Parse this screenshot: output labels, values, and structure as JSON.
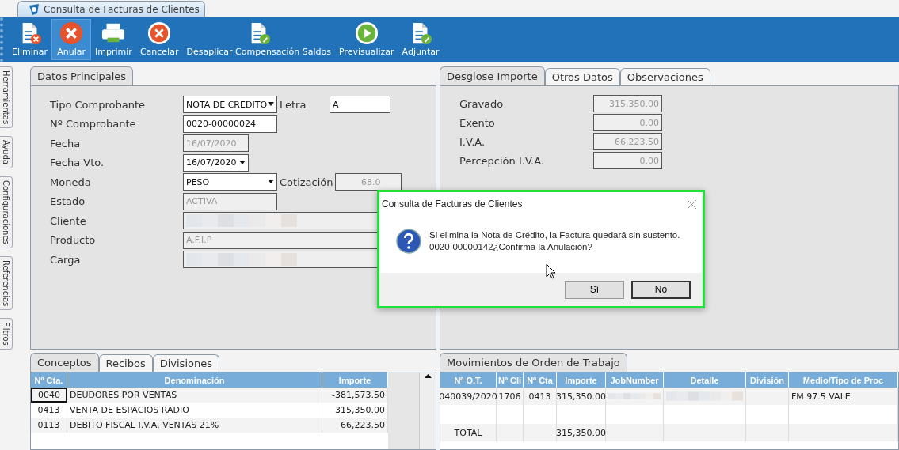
{
  "window": {
    "title": "Consulta de Facturas de Clientes"
  },
  "toolbar": [
    {
      "label": "Eliminar",
      "kind": "doc-x",
      "selected": false
    },
    {
      "label": "Anular",
      "kind": "x-circle",
      "selected": true
    },
    {
      "label": "Imprimir",
      "kind": "printer",
      "selected": false
    },
    {
      "label": "Cancelar",
      "kind": "x-ring",
      "selected": false
    },
    {
      "label": "Desaplicar Compensación Saldos",
      "kind": "doc-clip",
      "selected": false
    },
    {
      "label": "Previsualizar",
      "kind": "play",
      "selected": false
    },
    {
      "label": "Adjuntar",
      "kind": "doc-clip",
      "selected": false
    }
  ],
  "side_tabs": [
    "Herramientas",
    "Ayuda",
    "Configuraciones",
    "Referencias",
    "Filtros"
  ],
  "main_tabs": [
    {
      "label": "Datos Principales",
      "selected": true
    }
  ],
  "main_fields": [
    {
      "label": "Tipo Comprobante",
      "value": "NOTA DE CREDITO",
      "kind": "combo",
      "extra": {
        "label": "Letra",
        "value": "A",
        "kind": "input"
      }
    },
    {
      "label": "Nº Comprobante",
      "value": "0020-00000024",
      "kind": "input"
    },
    {
      "label": "Fecha",
      "value": "16/07/2020",
      "kind": "readonly"
    },
    {
      "label": "Fecha Vto.",
      "value": "16/07/2020",
      "kind": "combo"
    },
    {
      "label": "Moneda",
      "value": "PESO",
      "kind": "combo",
      "extra": {
        "label": "Cotización",
        "value": "68.0",
        "kind": "readonly"
      }
    },
    {
      "label": "Estado",
      "value": "ACTIVA",
      "kind": "readonly"
    },
    {
      "label": "Cliente",
      "kind": "readonly",
      "redacted": true
    },
    {
      "label": "Producto",
      "value": "A.F.I.P",
      "kind": "readonly"
    },
    {
      "label": "Carga",
      "kind": "readonly",
      "redacted": true
    }
  ],
  "detail_tabs": [
    {
      "label": "Desglose Importe",
      "selected": true
    },
    {
      "label": "Otros Datos",
      "selected": false
    },
    {
      "label": "Observaciones",
      "selected": false
    }
  ],
  "detail_fields": [
    {
      "label": "Gravado",
      "value": "315,350.00"
    },
    {
      "label": "Exento",
      "value": "0.00"
    },
    {
      "label": "I.V.A.",
      "value": "66,223.50"
    },
    {
      "label": "Percepción I.V.A.",
      "value": "0.00"
    }
  ],
  "concepts_tabs": [
    {
      "label": "Conceptos",
      "selected": true
    },
    {
      "label": "Recibos",
      "selected": false
    },
    {
      "label": "Divisiones",
      "selected": false
    }
  ],
  "concepts_table": {
    "columns": [
      "Nº Cta.",
      "Denominación",
      "Importe"
    ],
    "rows": [
      {
        "cells": [
          "0040",
          "DEUDORES POR VENTAS",
          "-381,573.50"
        ],
        "focused": true
      },
      {
        "cells": [
          "0413",
          "VENTA DE ESPACIOS RADIO",
          "315,350.00"
        ],
        "focused": false
      },
      {
        "cells": [
          "0113",
          "DEBITO FISCAL I.V.A. VENTAS 21%",
          "66,223.50"
        ],
        "focused": false
      }
    ]
  },
  "movements_tabs": [
    {
      "label": "Movimientos de Orden de Trabajo",
      "selected": true
    }
  ],
  "movements_table": {
    "columns": [
      "Nº O.T.",
      "Nº Cli",
      "Nº Cta",
      "Importe",
      "JobNumber",
      "Detalle",
      "División",
      "Medio/Tipo de Proc"
    ],
    "rows": [
      {
        "cells": [
          {
            "text": "040039/2020"
          },
          {
            "text": "1706"
          },
          {
            "text": "0413"
          },
          {
            "text": "315,350.00"
          },
          {
            "redacted": true
          },
          {
            "redacted": true
          },
          {},
          {
            "text": "FM 97.5 VALE"
          }
        ]
      },
      {
        "cells": [
          {},
          {},
          {},
          {},
          {},
          {},
          {},
          {}
        ]
      },
      {
        "cells": [
          {
            "text": "TOTAL"
          },
          {},
          {},
          {
            "text": "315,350.00"
          },
          {},
          {},
          {},
          {}
        ]
      }
    ]
  },
  "dialog": {
    "title": "Consulta de Facturas de Clientes",
    "message_lines": [
      "Si elimina la Nota de Crédito, la Factura quedará sin sustento.",
      "0020-00000142¿Confirma la Anulación?"
    ],
    "buttons": [
      {
        "label": "Sí",
        "default": false
      },
      {
        "label": "No",
        "default": true
      }
    ]
  }
}
